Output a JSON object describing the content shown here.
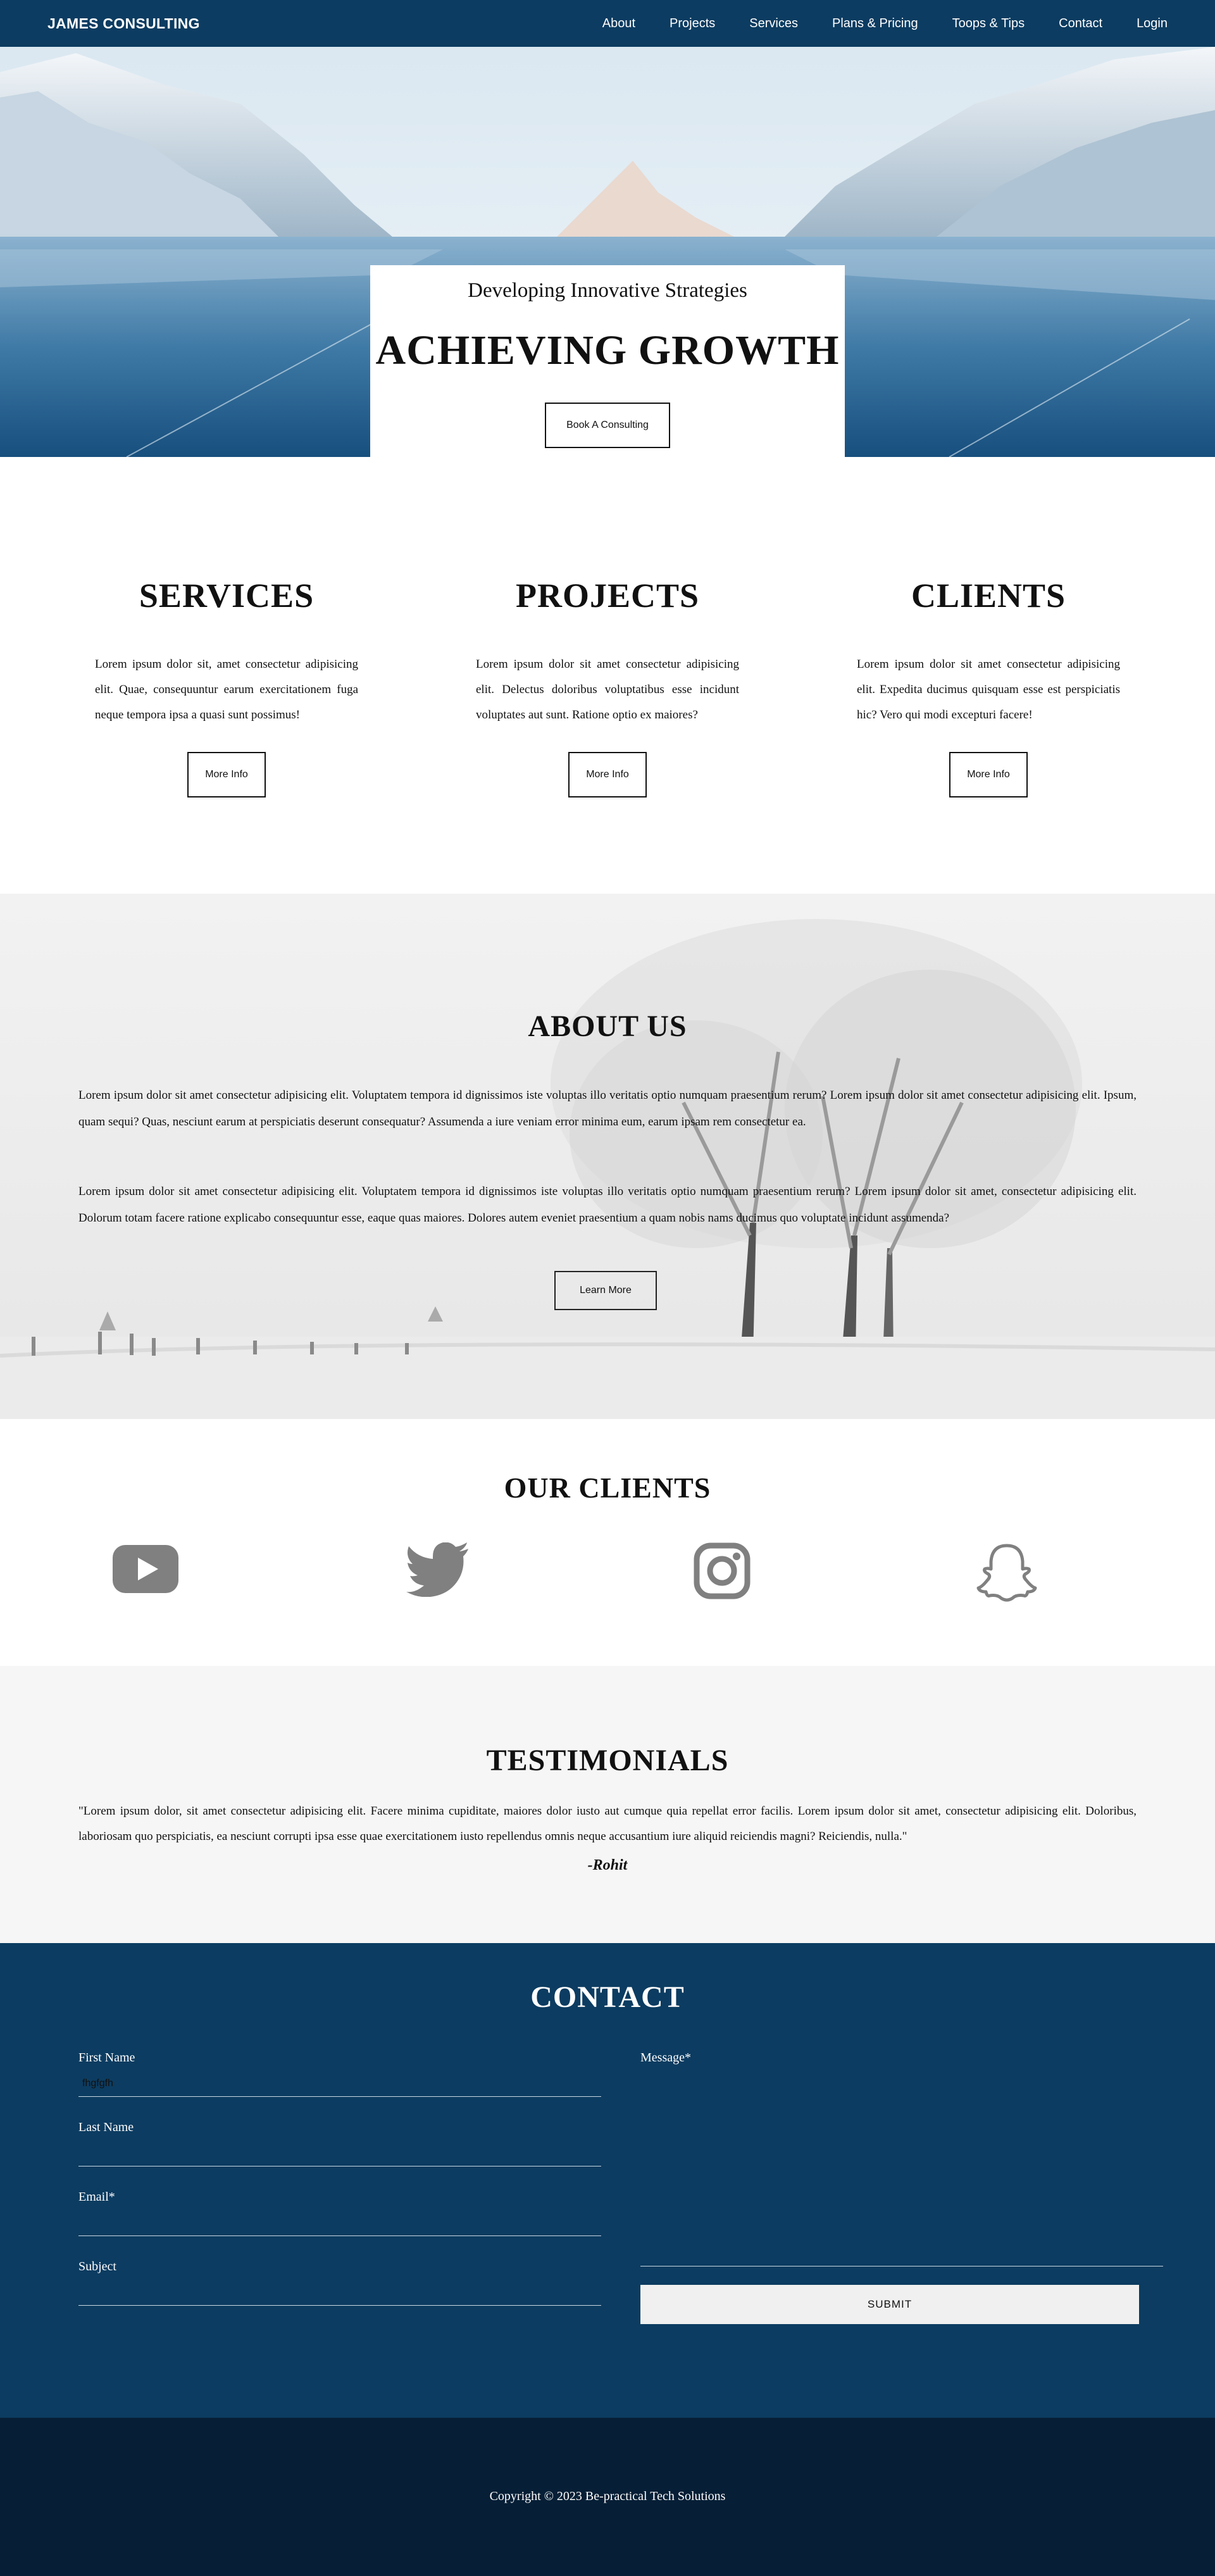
{
  "nav": {
    "brand": "JAMES CONSULTING",
    "links": [
      "About",
      "Projects",
      "Services",
      "Plans & Pricing",
      "Toops & Tips",
      "Contact",
      "Login"
    ]
  },
  "hero": {
    "subtitle": "Developing Innovative Strategies",
    "title": "ACHIEVING GROWTH",
    "button": "Book A Consulting"
  },
  "features": [
    {
      "title": "SERVICES",
      "text": "Lorem ipsum dolor sit, amet consectetur adipisicing elit. Quae, consequuntur earum exercitationem fuga neque tempora ipsa a quasi sunt possimus!",
      "button": "More Info"
    },
    {
      "title": "PROJECTS",
      "text": "Lorem ipsum dolor sit amet consectetur adipisicing elit. Delectus doloribus voluptatibus esse incidunt voluptates aut sunt. Ratione optio ex maiores?",
      "button": "More Info"
    },
    {
      "title": "CLIENTS",
      "text": "Lorem ipsum dolor sit amet consectetur adipisicing elit. Expedita ducimus quisquam esse est perspiciatis hic? Vero qui modi excepturi facere!",
      "button": "More Info"
    }
  ],
  "about": {
    "title": "ABOUT US",
    "p1": "Lorem ipsum dolor sit amet consectetur adipisicing elit. Voluptatem tempora id dignissimos iste voluptas illo veritatis optio numquam praesentium rerum? Lorem ipsum dolor sit amet consectetur adipisicing elit. Ipsum, quam sequi? Quas, nesciunt earum at perspiciatis deserunt consequatur? Assumenda a iure veniam error minima eum, earum ipsam rem consectetur ea.",
    "p2": "Lorem ipsum dolor sit amet consectetur adipisicing elit. Voluptatem tempora id dignissimos iste voluptas illo veritatis optio numquam praesentium rerum? Lorem ipsum dolor sit amet, consectetur adipisicing elit. Dolorum totam facere ratione explicabo consequuntur esse, eaque quas maiores. Dolores autem eveniet praesentium a quam nobis nams ducimus quo voluptate incidunt assumenda?",
    "button": "Learn More"
  },
  "clients": {
    "title": "OUR CLIENTS",
    "logos": [
      "youtube-icon",
      "twitter-icon",
      "instagram-icon",
      "snapchat-icon"
    ]
  },
  "testimonials": {
    "title": "TESTIMONIALS",
    "quote": "\"Lorem ipsum dolor, sit amet consectetur adipisicing elit. Facere minima cupiditate, maiores dolor iusto aut cumque quia repellat error facilis. Lorem ipsum dolor sit amet, consectetur adipisicing elit. Doloribus, laboriosam quo perspiciatis, ea nesciunt corrupti ipsa esse quae exercitationem iusto repellendus omnis neque accusantium iure aliquid reiciendis magni? Reiciendis, nulla.\"",
    "author": "-Rohit"
  },
  "contact": {
    "title": "CONTACT",
    "first_name_label": "First Name",
    "first_name_value": "fhgfgfh",
    "last_name_label": "Last Name",
    "email_label": "Email*",
    "subject_label": "Subject",
    "message_label": "Message*",
    "submit": "SUBMIT"
  },
  "footer": {
    "copyright": "Copyright © 2023 Be-practical Tech Solutions"
  },
  "colors": {
    "primary": "#0c3c61",
    "footer": "#061f36",
    "section_gray": "#f6f6f6",
    "icon_gray": "#808080"
  }
}
